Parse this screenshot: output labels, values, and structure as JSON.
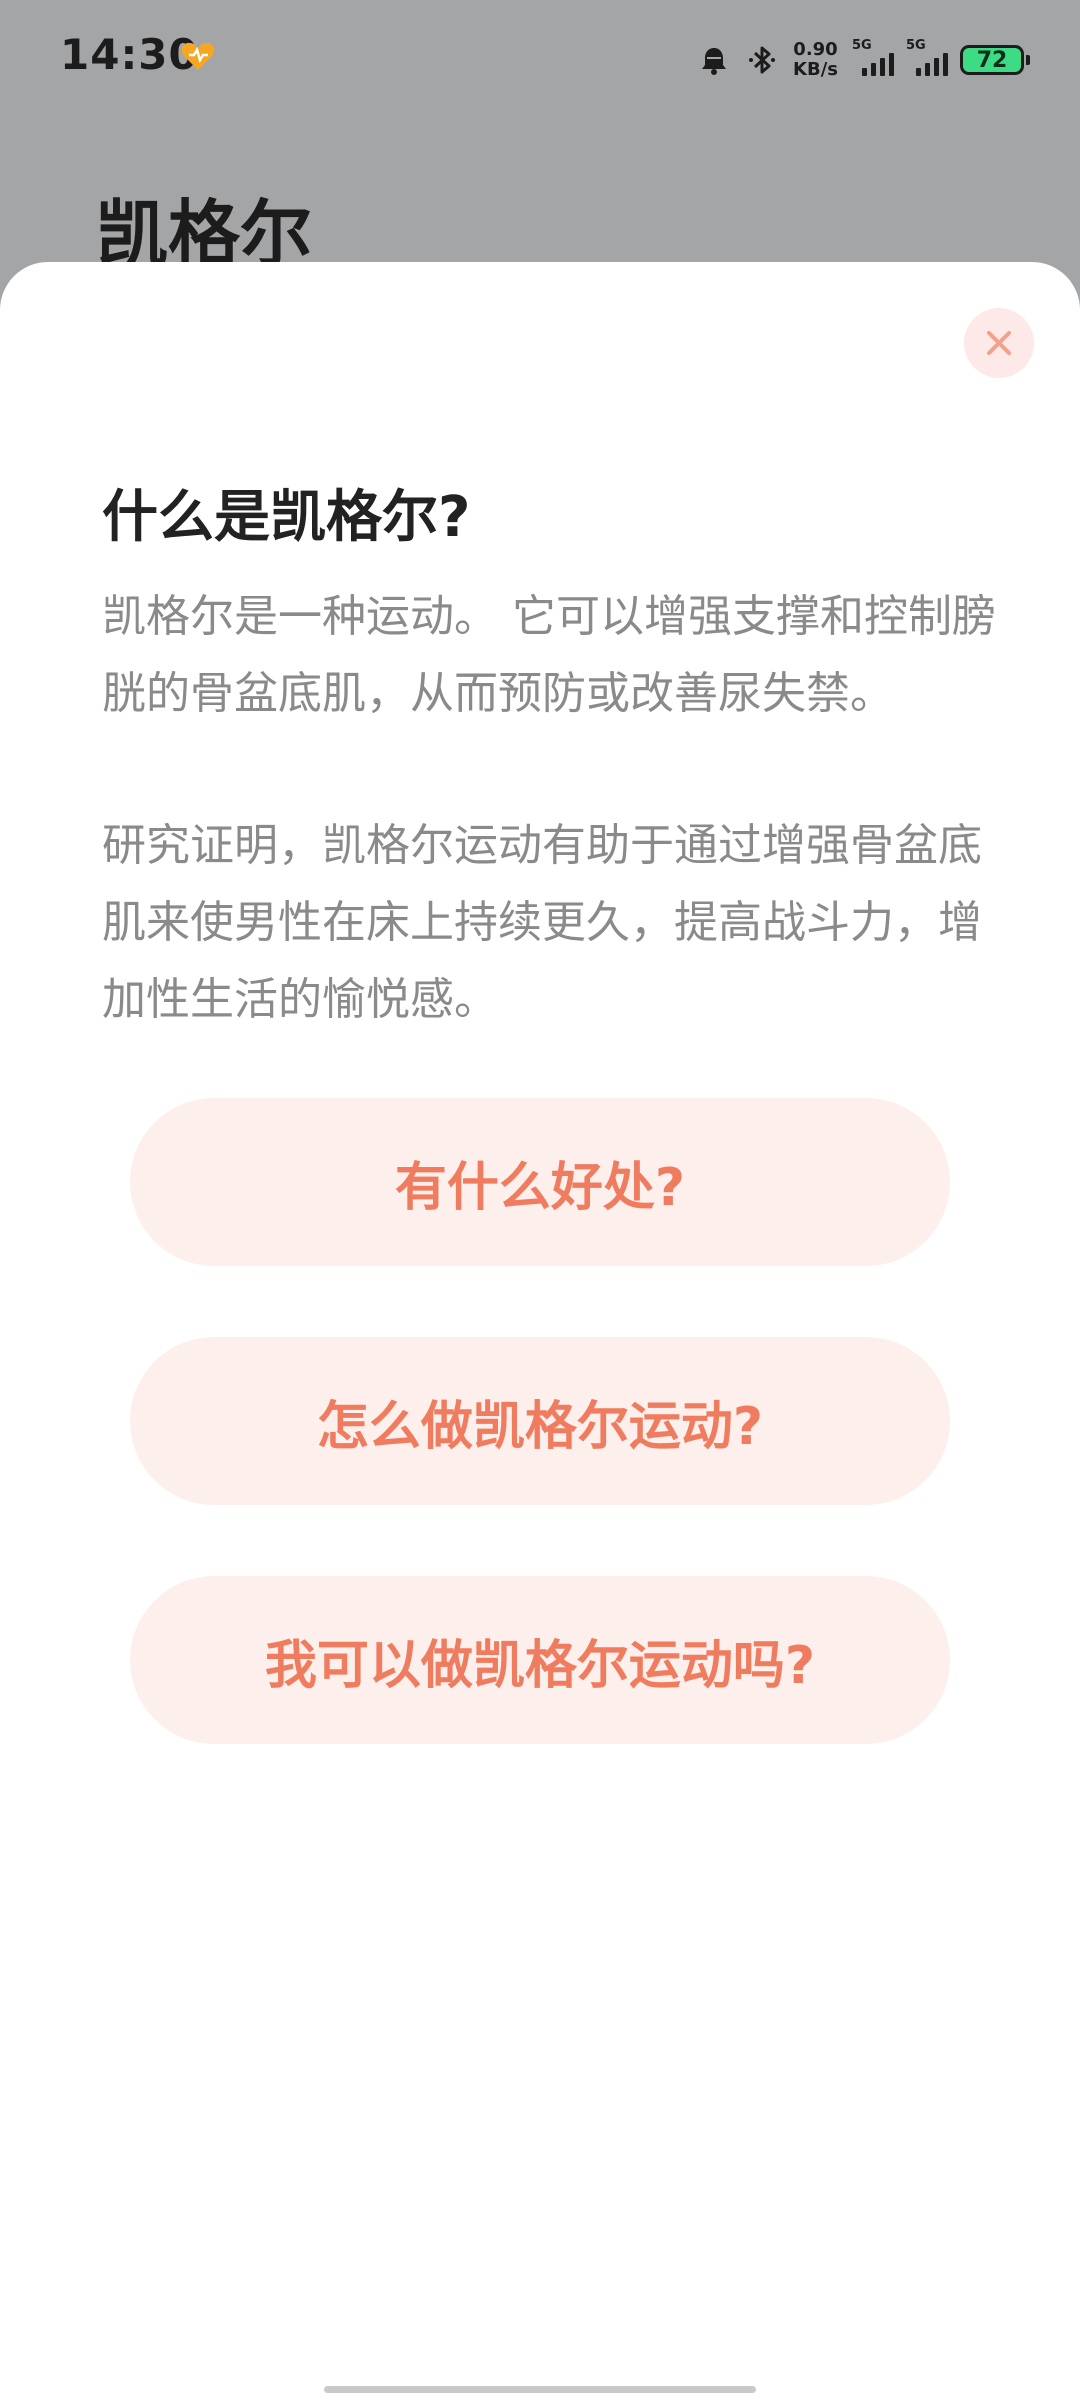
{
  "status_bar": {
    "time": "14:30",
    "net_speed_value": "0.90",
    "net_speed_unit": "KB/s",
    "signal1_tag": "5G",
    "signal2_tag": "5G",
    "battery_level": "72",
    "battery_color": "#3ddc84",
    "icons": [
      "heart-app-icon",
      "alarm-icon",
      "bluetooth-icon",
      "signal-icon",
      "battery-icon"
    ]
  },
  "background": {
    "title": "凯格尔"
  },
  "sheet": {
    "heading": "什么是凯格尔?",
    "paragraph1": "凯格尔是一种运动。 它可以增强支撑和控制膀胱的骨盆底肌，从而预防或改善尿失禁。",
    "paragraph2": "研究证明，凯格尔运动有助于通过增强骨盆底肌来使男性在床上持续更久，提高战斗力，增加性生活的愉悦感。",
    "buttons": [
      {
        "label": "有什么好处?"
      },
      {
        "label": "怎么做凯格尔运动?"
      },
      {
        "label": "我可以做凯格尔运动吗?"
      }
    ],
    "accent_color": "#f07c5f",
    "button_bg_color": "#fdefec"
  }
}
